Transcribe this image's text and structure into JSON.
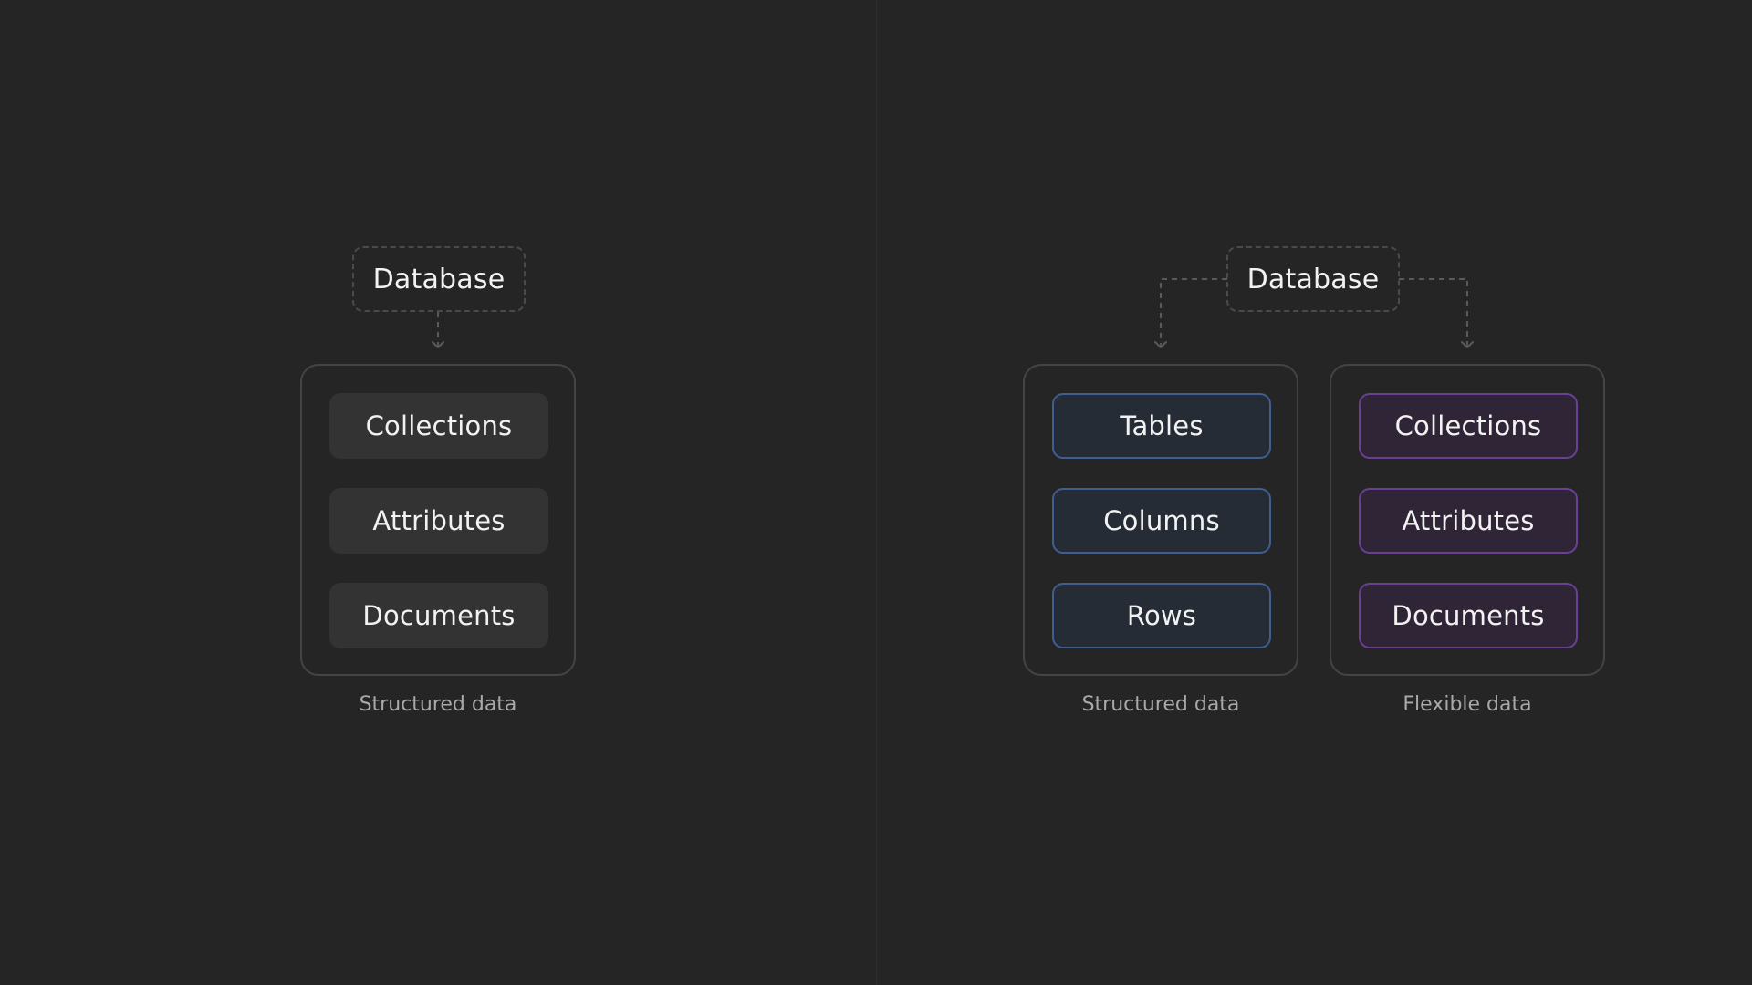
{
  "colors": {
    "background": "#252525",
    "neutral_fill": "#333333",
    "blue_border": "#3f5f8f",
    "purple_border": "#6b3f95",
    "connector": "#5a5a5a"
  },
  "left_diagram": {
    "database_label": "Database",
    "group": {
      "items": [
        "Collections",
        "Attributes",
        "Documents"
      ],
      "caption": "Structured data"
    }
  },
  "right_diagram": {
    "database_label": "Database",
    "groups": [
      {
        "items": [
          "Tables",
          "Columns",
          "Rows"
        ],
        "caption": "Structured data"
      },
      {
        "items": [
          "Collections",
          "Attributes",
          "Documents"
        ],
        "caption": "Flexible data"
      }
    ]
  }
}
